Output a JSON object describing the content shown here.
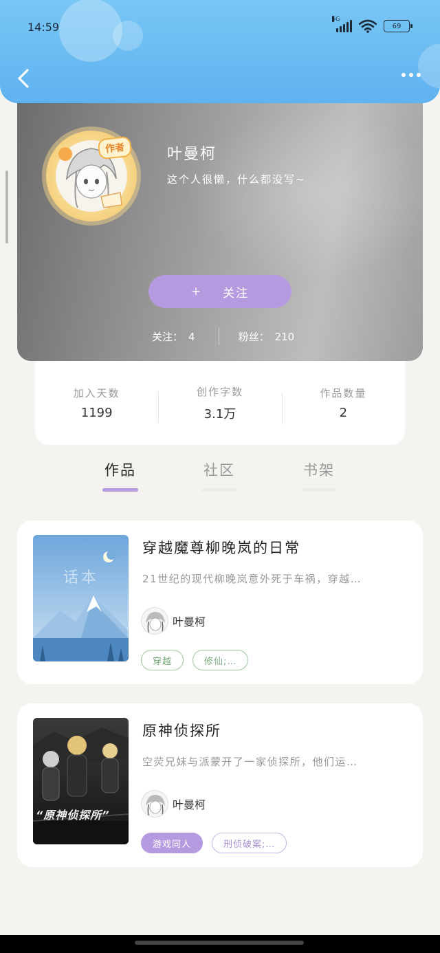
{
  "status_bar": {
    "time": "14:59",
    "network": "5G",
    "battery": "69"
  },
  "header": {
    "back_icon": "chevron-left-icon",
    "more_icon": "more-dots-icon"
  },
  "profile": {
    "avatar_badge": "作者",
    "name": "叶曼柯",
    "bio": "这个人很懒，什么都没写~",
    "follow_button": {
      "plus": "+",
      "label": "关注"
    },
    "following_label": "关注：",
    "following_count": "4",
    "fans_label": "粉丝：",
    "fans_count": "210"
  },
  "stats": [
    {
      "label": "加入天数",
      "value": "1199"
    },
    {
      "label": "创作字数",
      "value": "3.1万"
    },
    {
      "label": "作品数量",
      "value": "2"
    }
  ],
  "tabs": [
    {
      "label": "作品",
      "active": true
    },
    {
      "label": "社区",
      "active": false
    },
    {
      "label": "书架",
      "active": false
    }
  ],
  "books": [
    {
      "title": "穿越魔尊柳晚岚的日常",
      "description": "21世纪的现代柳晚岚意外死于车祸，穿越…",
      "author": "叶曼柯",
      "cover_text": "话本",
      "tags": [
        "穿越",
        "修仙;…"
      ]
    },
    {
      "title": "原神侦探所",
      "description": "空荧兄妹与派蒙开了一家侦探所，他们运…",
      "author": "叶曼柯",
      "cover_text": "“原神侦探所”",
      "tags": [
        "游戏同人",
        "刑侦破案;…"
      ]
    }
  ],
  "colors": {
    "accent": "#b69ae0",
    "header_blue": "#5fb2f0",
    "tag_green": "#7aac7d"
  }
}
